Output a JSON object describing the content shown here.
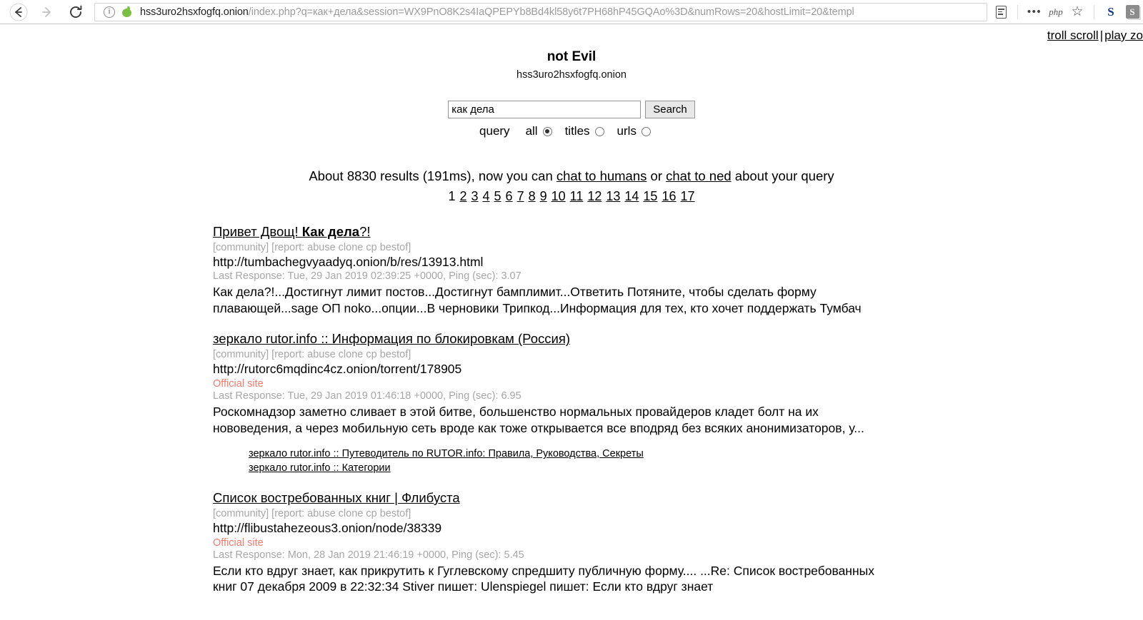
{
  "browser": {
    "back_icon": "back-arrow-icon",
    "forward_icon": "forward-arrow-icon",
    "reload_icon": "reload-icon",
    "info_icon": "info-icon",
    "site_icon": "onion-icon",
    "url_host": "hss3uro2hsxfogfq.onion",
    "url_path": "/index.php?q=как+дела&session=WX9PnO8K2s4IaQPEPYb8Bd4kl58y6t7PH68hP45GQAo%3D&numRows=20&hostLimit=20&templ",
    "toolbar": {
      "reader_icon": "reader-view-icon",
      "menu_dots": "•••",
      "php_label": "php",
      "star_glyph": "☆",
      "ext_s_blue": "S",
      "ext_s_gray": "S"
    }
  },
  "page": {
    "top_links": [
      {
        "label": "troll scroll"
      },
      {
        "label": "play zo"
      }
    ],
    "top_links_separator": "|",
    "title": "not Evil",
    "subtitle": "hss3uro2hsxfogfq.onion",
    "search": {
      "value": "как дела",
      "placeholder": "",
      "button_label": "Search"
    },
    "scope": {
      "label": "query",
      "options": [
        {
          "label": "all",
          "selected": true
        },
        {
          "label": "titles",
          "selected": false
        },
        {
          "label": "urls",
          "selected": false
        }
      ]
    },
    "result_info": {
      "prefix": "About 8830 results (191ms), now you can ",
      "link1": "chat to humans",
      "middle": " or ",
      "link2": "chat to ned",
      "suffix": " about your query"
    },
    "pagination": {
      "current": "1",
      "pages": [
        "2",
        "3",
        "4",
        "5",
        "6",
        "7",
        "8",
        "9",
        "10",
        "11",
        "12",
        "13",
        "14",
        "15",
        "16",
        "17"
      ]
    },
    "results": [
      {
        "title_plain": "Привет Двощ! ",
        "title_bold": "Как дела",
        "title_tail": "?!",
        "meta": "[community] [report: abuse clone cp bestof]",
        "url": "http://tumbachegvyaadyq.onion/b/res/13913.html",
        "official": "",
        "last_response": "Last Response: Tue, 29 Jan 2019 02:39:25 +0000, Ping (sec): 3.07",
        "snippet": "Как дела?!...Достигнут лимит постов...Достигнут бамплимит...Ответить Потяните, чтобы сделать форму плавающей...sage ОП noko...опции...В черновики Трипкод...Информация для тех, кто хочет поддержать Тумбач",
        "sublinks": []
      },
      {
        "title_plain": "зеркало rutor.info :: Информация по блокировкам (Россия)",
        "title_bold": "",
        "title_tail": "",
        "meta": "[community] [report: abuse clone cp bestof]",
        "url": "http://rutorc6mqdinc4cz.onion/torrent/178905",
        "official": "Official site",
        "last_response": "Last Response: Tue, 29 Jan 2019 01:46:18 +0000, Ping (sec): 6.95",
        "snippet": "Роскомнадзор заметно сливает в этой битве, большенство нормальных провайдеров кладет болт на их нововедения, а через мобильную сеть вроде как тоже открывается все вподряд без всяких анонимизаторов, у...",
        "sublinks": [
          "зеркало rutor.info :: Путеводитель по RUTOR.info: Правила, Руководства, Секреты",
          "зеркало rutor.info :: Категории"
        ]
      },
      {
        "title_plain": "Список востребованных книг | Флибуста",
        "title_bold": "",
        "title_tail": "",
        "meta": "[community] [report: abuse clone cp bestof]",
        "url": "http://flibustahezeous3.onion/node/38339",
        "official": "Official site",
        "last_response": "Last Response: Mon, 28 Jan 2019 21:46:19 +0000, Ping (sec): 5.45",
        "snippet": "Если кто вдруг знает, как прикрутить к Гуглевскому спредшиту публичную форму.... ...Re: Список востребованных книг  07 декабря 2009  в 22:32:34 Stiver пишет:   Ulenspiegel пишет:   Если кто вдруг знает",
        "sublinks": []
      }
    ]
  },
  "colors": {
    "official_site": "#f4796b",
    "meta_gray": "#a6a6a6",
    "onion_green": "#7bc043",
    "ext_blue": "#1a3a8f"
  }
}
